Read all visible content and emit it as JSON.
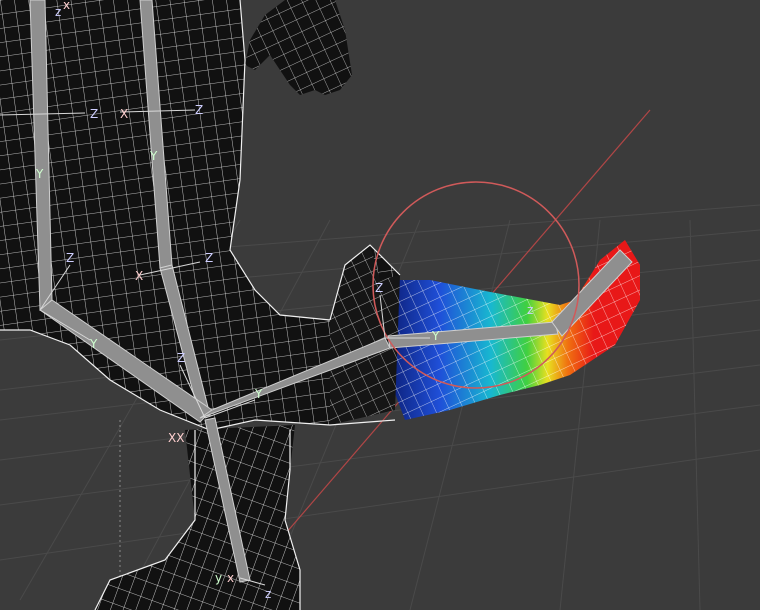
{
  "viewport": {
    "background": "#3b3b3b",
    "grid_color": "#4a4a4a",
    "mesh_color": "#f2f2f2",
    "bone_color": "#9a9a9a",
    "selection_circle_color": "#d65a5a",
    "axis_line_color": "#c04a4a",
    "weight_colors": [
      "#0a1a6e",
      "#1f4fd8",
      "#18b8d0",
      "#40d040",
      "#e8e020",
      "#f07010",
      "#e81818"
    ]
  },
  "gizmo_labels": {
    "z": "Z",
    "y": "Y",
    "x": "X",
    "z_small": "z",
    "y_small": "y",
    "x_small": "x",
    "xx": "XX"
  },
  "icons": [
    "rotation-gizmo-icon",
    "axis-tripod-icon"
  ]
}
